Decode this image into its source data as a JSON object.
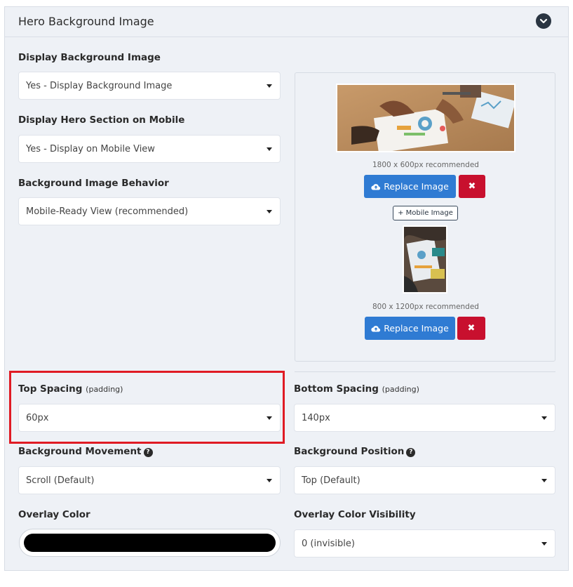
{
  "panel": {
    "title": "Hero Background Image",
    "collapse_icon": "chevron-down-icon"
  },
  "display_bg": {
    "label": "Display Background Image",
    "value": "Yes - Display Background Image"
  },
  "display_mobile": {
    "label": "Display Hero Section on Mobile",
    "value": "Yes - Display on Mobile View"
  },
  "bg_behavior": {
    "label": "Background Image Behavior",
    "value": "Mobile-Ready View (recommended)"
  },
  "images": {
    "desktop_recommended": "1800 x 600px recommended",
    "replace_label": "Replace Image",
    "replace_label_2": "Replace Image",
    "delete_label": "✖",
    "mobile_button": "+ Mobile Image",
    "mobile_recommended": "800 x 1200px recommended",
    "upload_icon": "cloud-upload-icon"
  },
  "top_spacing": {
    "label": "Top Spacing",
    "sub": "(padding)",
    "value": "60px"
  },
  "bottom_spacing": {
    "label": "Bottom Spacing",
    "sub": "(padding)",
    "value": "140px"
  },
  "bg_movement": {
    "label": "Background Movement",
    "value": "Scroll (Default)"
  },
  "bg_position": {
    "label": "Background Position",
    "value": "Top (Default)"
  },
  "overlay_color": {
    "label": "Overlay Color",
    "color": "#000000"
  },
  "overlay_visibility": {
    "label": "Overlay Color Visibility",
    "value": "0 (invisible)"
  },
  "colors": {
    "accent_blue": "#2f7bd3",
    "danger_red": "#c8102e",
    "highlight_red": "#e01b24",
    "panel_bg": "#eef1f6"
  }
}
